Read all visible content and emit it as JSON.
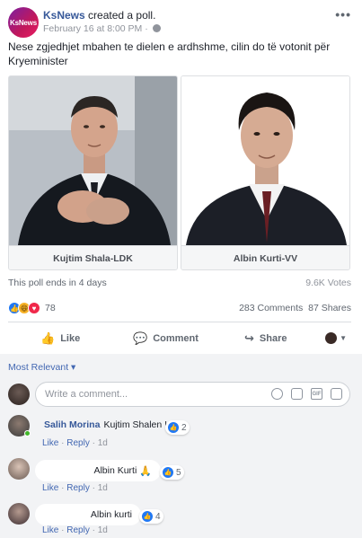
{
  "post": {
    "page_avatar_text": "KsNews",
    "page_name": "KsNews",
    "action_text": " created a poll.",
    "timestamp": "February 16 at 8:00 PM",
    "separator": " · ",
    "audience_icon": "globe-icon",
    "more_icon": "more-options-icon",
    "text": "Nese zgjedhjet mbahen te dielen e ardhshme, cilin do të votonit për Kryeminister"
  },
  "poll": {
    "options": [
      {
        "label": "Kujtim Shala-LDK"
      },
      {
        "label": "Albin Kurti-VV"
      }
    ],
    "ends_text": "This poll ends in 4 days",
    "votes_text": "9.6K Votes"
  },
  "reactions": {
    "icons": [
      "like-reaction-icon",
      "haha-reaction-icon",
      "love-reaction-icon"
    ],
    "count": "78",
    "comments": "283 Comments",
    "shares": "87 Shares"
  },
  "actions": {
    "like": "Like",
    "comment": "Comment",
    "share": "Share"
  },
  "sort_label": "Most Relevant ▾",
  "comment_box": {
    "placeholder": "Write a comment..."
  },
  "comments": [
    {
      "author": "Salih Morina",
      "text": "Kujtim Shalen !",
      "reactions": "2",
      "like": "Like",
      "reply": "Reply",
      "time": "1d"
    },
    {
      "author": "",
      "text": "Albin Kurti",
      "reactions": "5",
      "like": "Like",
      "reply": "Reply",
      "time": "1d"
    },
    {
      "author": "",
      "text": "Albin kurti",
      "reactions": "4",
      "like": "Like",
      "reply": "Reply",
      "time": "1d"
    }
  ],
  "colors": {
    "link_blue": "#365899",
    "like_blue": "#2078f4",
    "action_gray": "#606770",
    "meta_gray": "#90949c"
  }
}
